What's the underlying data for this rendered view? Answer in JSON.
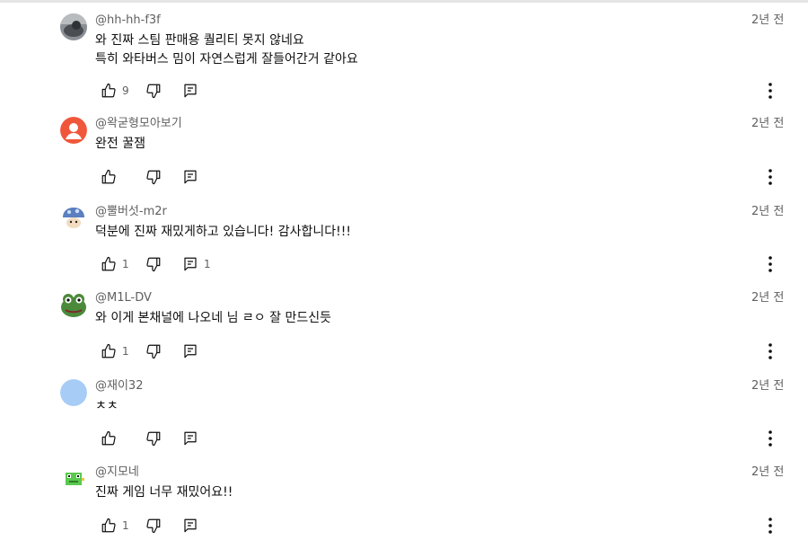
{
  "comments": [
    {
      "author": "@hh-hh-f3f",
      "time": "2년 전",
      "lines": [
        "와 진짜 스팀 판매용 퀄리티 못지 않네요",
        "특히 와타버스 밈이 자연스럽게 잘들어간거 같아요"
      ],
      "likes": "9",
      "replies": "",
      "avatar_icon": "photo-avatar-icon",
      "avatar_color": "#6f747a"
    },
    {
      "author": "@왁굳형모아보기",
      "time": "2년 전",
      "lines": [
        "완전 꿀잼"
      ],
      "likes": "",
      "replies": "",
      "avatar_icon": "default-user-avatar-icon",
      "avatar_color": "#f0573a"
    },
    {
      "author": "@뿔버섯-m2r",
      "time": "2년 전",
      "lines": [
        "덕분에 진짜 재밌게하고 있습니다! 감사합니다!!!"
      ],
      "likes": "1",
      "replies": "1",
      "avatar_icon": "mushroom-avatar-icon",
      "avatar_color": "#6b8fcf"
    },
    {
      "author": "@M1L-DV",
      "time": "2년 전",
      "lines": [
        "와 이게 본채널에 나오네 님 ㄹㅇ 잘 만드신듯"
      ],
      "likes": "1",
      "replies": "",
      "avatar_icon": "frog-avatar-icon",
      "avatar_color": "#4b8a3a"
    },
    {
      "author": "@재이32",
      "time": "2년 전",
      "lines": [
        "ㅊㅊ"
      ],
      "likes": "",
      "replies": "",
      "avatar_icon": "blank-avatar-icon",
      "avatar_color": "#a7ccf5"
    },
    {
      "author": "@지모네",
      "time": "2년 전",
      "lines": [
        "진짜 게임 너무 재밌어요!!"
      ],
      "likes": "1",
      "replies": "",
      "avatar_icon": "pixel-frog-avatar-icon",
      "avatar_color": "#5ac94f"
    }
  ]
}
